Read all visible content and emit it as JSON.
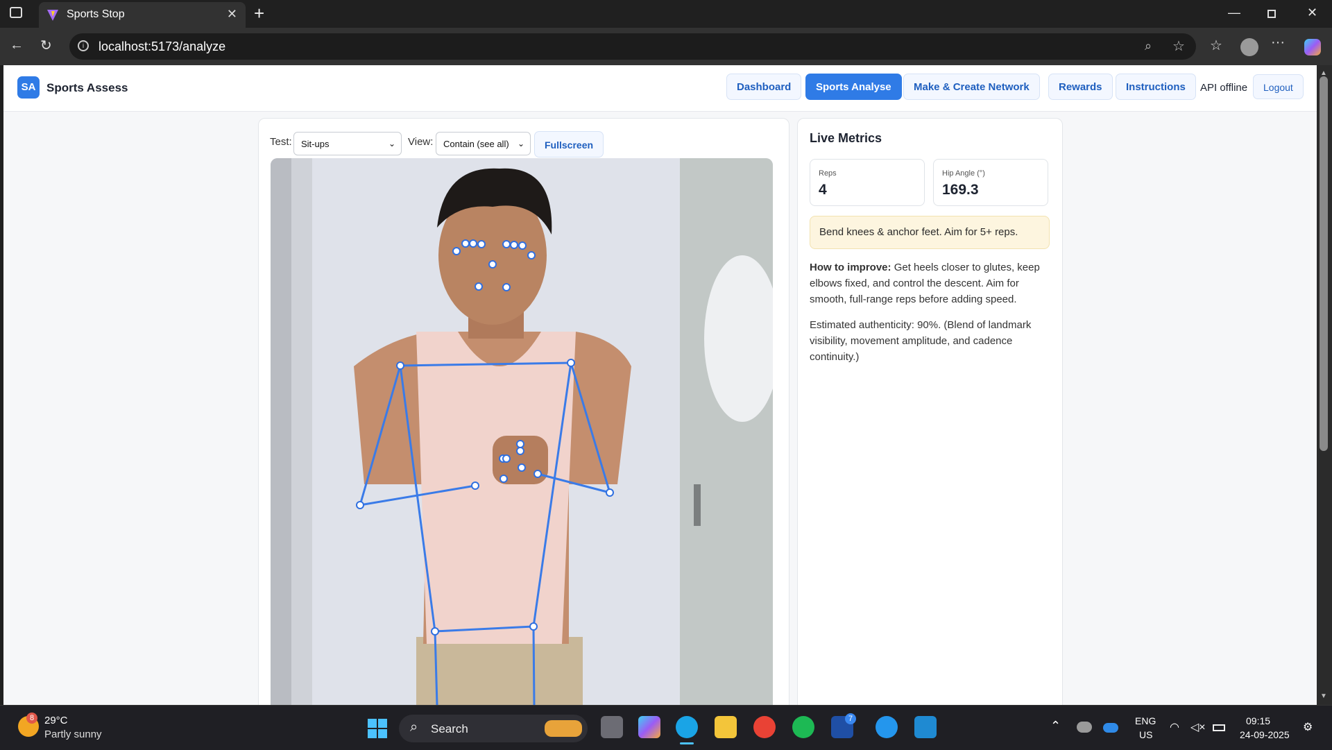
{
  "browser": {
    "tab_title": "Sports Stop",
    "url": "localhost:5173/analyze"
  },
  "app": {
    "logo_text": "SA",
    "brand": "Sports Assess",
    "nav": [
      "Dashboard",
      "Sports Analyse",
      "Make & Create Network",
      "Rewards",
      "Instructions"
    ],
    "active_nav": "Sports Analyse",
    "api_status": "API offline",
    "logout_label": "Logout"
  },
  "controls": {
    "test_label": "Test:",
    "test_value": "Sit-ups",
    "view_label": "View:",
    "view_value": "Contain (see all)",
    "fullscreen_label": "Fullscreen"
  },
  "metrics": {
    "title": "Live Metrics",
    "reps_label": "Reps",
    "reps_value": "4",
    "hip_label": "Hip Angle (°)",
    "hip_value": "169.3",
    "tip": "Bend knees & anchor feet. Aim for 5+ reps.",
    "improve_heading": "How to improve:",
    "improve_text": "Get heels closer to glutes, keep elbows fixed, and control the descent. Aim for smooth, full-range reps before adding speed.",
    "authenticity": "Estimated authenticity: 90%. (Blend of landmark visibility, movement amplitude, and cadence continuity.)"
  },
  "taskbar": {
    "weather_temp": "29°C",
    "weather_desc": "Partly sunny",
    "weather_badge": "8",
    "search_label": "Search",
    "lang": "ENG",
    "region": "US",
    "time": "09:15",
    "date": "24-09-2025",
    "badge_l": "7"
  },
  "colors": {
    "accent": "#2f7be6",
    "skeleton": "#3a7be8"
  }
}
